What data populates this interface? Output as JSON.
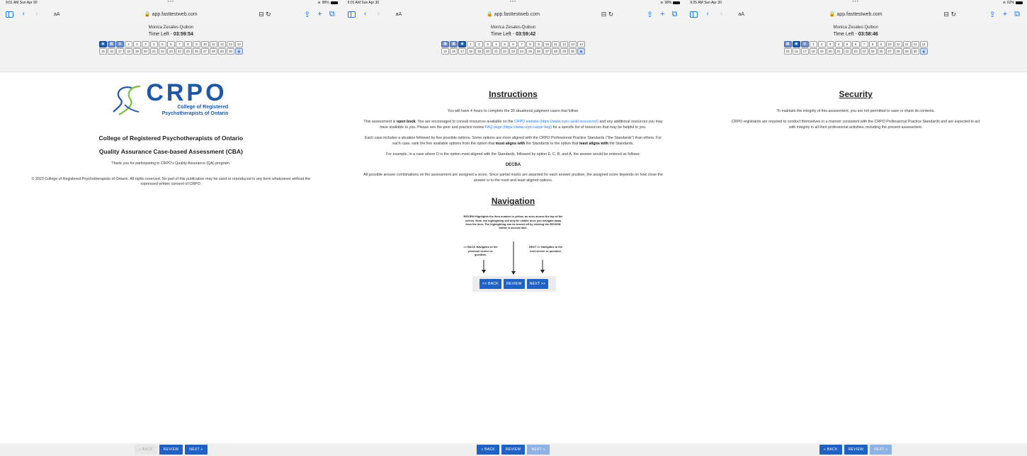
{
  "shots": [
    {
      "status": {
        "time": "9:01 AM  Sun Apr 30",
        "battery": "98%"
      },
      "url": "app.fasttestweb.com",
      "user": "Monica Zesales-Quibon",
      "time_left_label": "Time Left - ",
      "time_left": "03:59:54",
      "footer": {
        "back": "« BACK",
        "review": "REVIEW",
        "next": "NEXT »"
      }
    },
    {
      "status": {
        "time": "9:01 AM  Sun Apr 30",
        "battery": "98%"
      },
      "url": "app.fasttestweb.com",
      "user": "Monica Zesales-Quibon",
      "time_left_label": "Time Left - ",
      "time_left": "03:59:42",
      "footer": {
        "back": "« BACK",
        "review": "REVIEW",
        "next": "NEXT »"
      }
    },
    {
      "status": {
        "time": "9:25 AM  Sun Apr 30",
        "battery": "62%"
      },
      "url": "app.fasttestweb.com",
      "user": "Monica Zesales-Quibon",
      "time_left_label": "Time Left - ",
      "time_left": "03:58:46",
      "footer": {
        "back": "« BACK",
        "review": "REVIEW",
        "next": "NEXT »"
      }
    }
  ],
  "grid_row1": [
    "1",
    "2",
    "3",
    "4",
    "5",
    "6",
    "7",
    "8",
    "9",
    "10",
    "11",
    "12",
    "13",
    "14"
  ],
  "grid_row2": [
    "15",
    "16",
    "17",
    "18",
    "19",
    "20",
    "21",
    "22",
    "23",
    "24",
    "25",
    "26",
    "27",
    "28",
    "29",
    "30"
  ],
  "welcome": {
    "logo_text": "CRPO",
    "logo_sub1": "College of Registered",
    "logo_sub2": "Psychotherapists of Ontario",
    "org": "College of Registered Psychotherapists of Ontario",
    "cba": "Quality Assurance Case-based Assessment (CBA)",
    "thanks": "Thank you for participating in CRPO's Quality Assurance (QA) program.",
    "copyright": "© 2023 College of Registered Psychotherapists of Ontario. All rights reserved. No part of this publication may be used or reproduced in any form whatsoever without the expressed written consent of CRPO."
  },
  "instructions": {
    "title": "Instructions",
    "p1": "You will have 4 hours to complete the 30 situational judgment cases that follow.",
    "p2_a": "This assessment is ",
    "p2_bold": "open book",
    "p2_b": ". You are encouraged to consult resources available on the ",
    "p2_link1": "CRPO website (https://www.crpo.ca/all-resources/)",
    "p2_c": " and any additional resources you may have available to you. Please see the peer and practice review ",
    "p2_link2": "FAQ page (https://www.crpo.ca/ppr-faq/)",
    "p2_d": " for a specific list of resources that may be helpful to you.",
    "p3_a": "Each case includes a situation followed by five possible options. Some options are more aligned with the CRPO Professional Practice Standards (\"the Standards\") than others. For each case, rank the five available options from the option that ",
    "p3_bold1": "most aligns with",
    "p3_b": " the Standards to the option that ",
    "p3_bold2": "least aligns with",
    "p3_c": " the Standards.",
    "p4": "For example, in a case where D is the option most aligned with the Standards, followed by option E, C, B, and A, the answer would be entered as follows:",
    "example": "DECBA",
    "p5": "All possible answer combinations on the assessment are assigned a score. Since partial marks are awarded for each answer position, the assigned score depends on how close the answer is to the most and least aligned options.",
    "nav_title": "Navigation",
    "fig_review": "REVIEW Highlights the item number in yellow, as seen across the top of the screen. Note, the highlighting will only be visible once you navigate away from the item. The highlighting can be turned off by clicking the REVIEW button a second time.",
    "fig_back": "<< BACK Navigates to the previous screen or question.",
    "fig_next": "NEXT >> Navigates to the next screen or question.",
    "fig_btn_back": "<< BACK",
    "fig_btn_review": "REVIEW",
    "fig_btn_next": "NEXT >>"
  },
  "security": {
    "title": "Security",
    "p1": "To maintain the integrity of this assessment, you are not permitted to save or share its contents.",
    "p2": "CRPO registrants are required to conduct themselves in a manner consistent with the CRPO Professional Practice Standards and are expected to act with integrity in all their professional activities, including the present assessment."
  },
  "colors": {
    "accent": "#1f62c4",
    "logo": "#1f57a4",
    "logo_swoosh": "#7bbf3a",
    "link": "#2a7ae2"
  }
}
